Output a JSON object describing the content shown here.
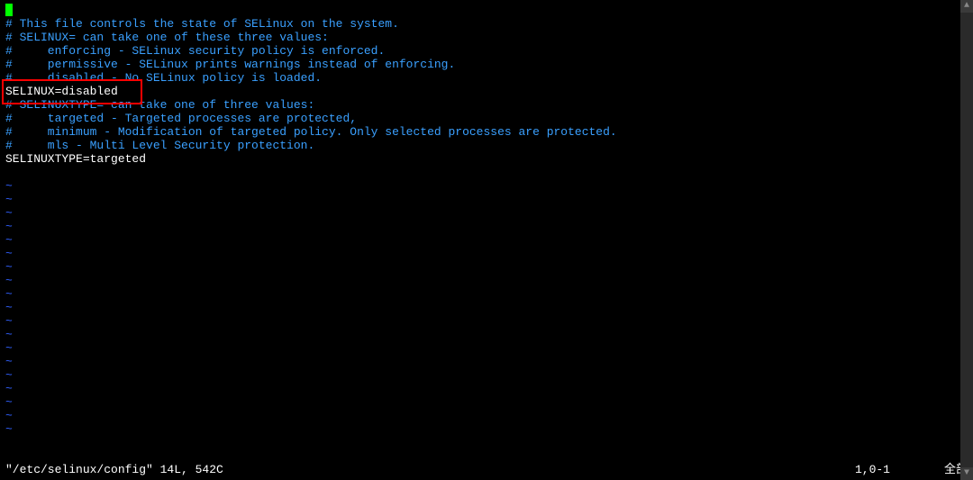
{
  "editor": {
    "cursor_visible": true,
    "lines": [
      {
        "type": "cursor_line",
        "prefix": "",
        "cursor": true
      },
      {
        "type": "comment",
        "text": "# This file controls the state of SELinux on the system."
      },
      {
        "type": "comment",
        "text": "# SELINUX= can take one of these three values:"
      },
      {
        "type": "comment",
        "text": "#     enforcing - SELinux security policy is enforced."
      },
      {
        "type": "comment",
        "text": "#     permissive - SELinux prints warnings instead of enforcing."
      },
      {
        "type": "comment",
        "text": "#     disabled - No SELinux policy is loaded."
      },
      {
        "type": "config",
        "text": "SELINUX=disabled"
      },
      {
        "type": "comment",
        "text": "# SELINUXTYPE= can take one of three values:"
      },
      {
        "type": "comment",
        "text": "#     targeted - Targeted processes are protected,"
      },
      {
        "type": "comment",
        "text": "#     minimum - Modification of targeted policy. Only selected processes are protected."
      },
      {
        "type": "comment",
        "text": "#     mls - Multi Level Security protection."
      },
      {
        "type": "config",
        "text": "SELINUXTYPE=targeted"
      }
    ],
    "empty_tilde": "~",
    "tilde_count": 19
  },
  "status": {
    "file_info": "\"/etc/selinux/config\" 14L, 542C",
    "position": "1,0-1",
    "scroll": "全部"
  },
  "scrollbar": {
    "up_arrow": "▲",
    "down_arrow": "▼"
  }
}
